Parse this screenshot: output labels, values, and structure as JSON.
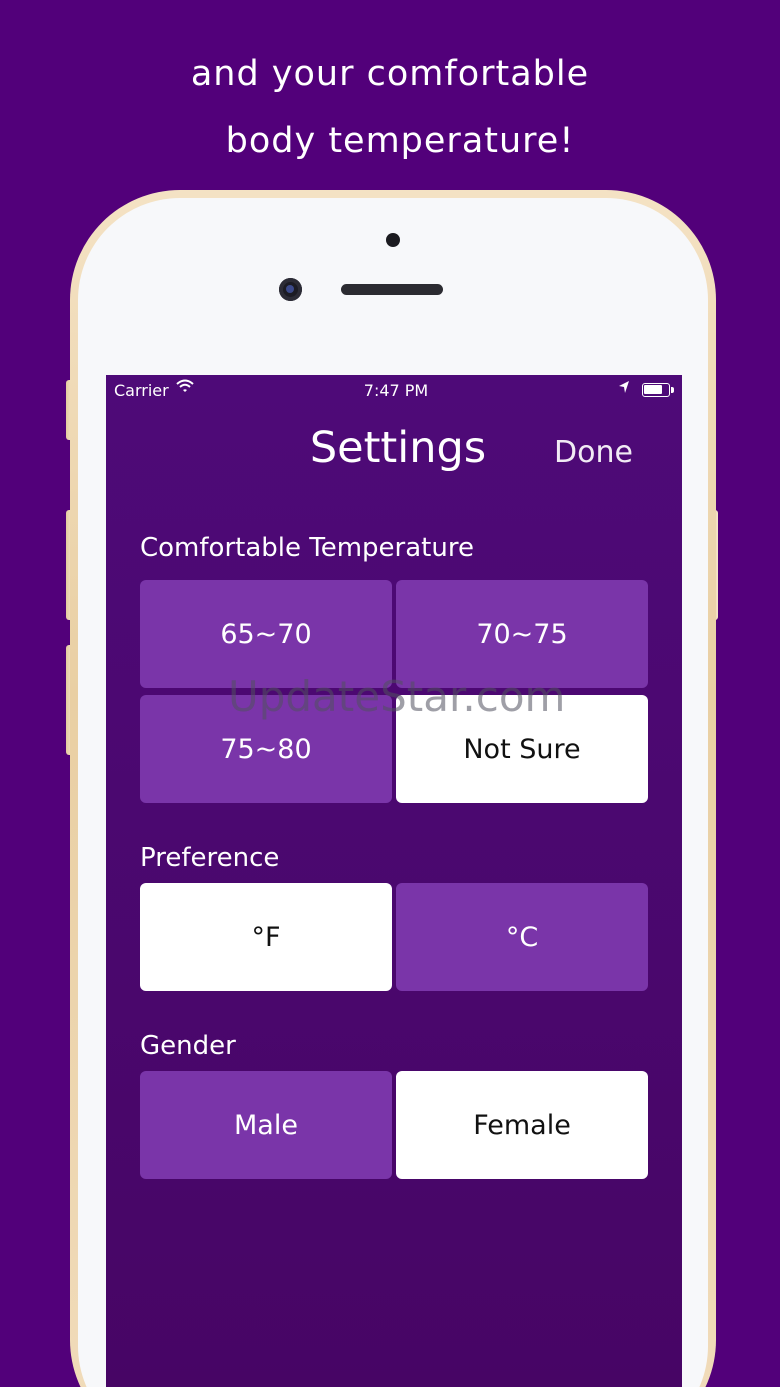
{
  "caption": {
    "line1": "and your comfortable",
    "line2": "body temperature!"
  },
  "status_bar": {
    "carrier": "Carrier",
    "wifi_icon": "wifi-icon",
    "time": "7:47 PM",
    "location_icon": "location-arrow-icon",
    "battery_icon": "battery-icon"
  },
  "nav": {
    "title": "Settings",
    "done_label": "Done"
  },
  "sections": {
    "temperature": {
      "label": "Comfortable Temperature",
      "options": [
        "65~70",
        "70~75",
        "75~80",
        "Not Sure"
      ],
      "selected": "Not Sure"
    },
    "preference": {
      "label": "Preference",
      "options": [
        "°F",
        "°C"
      ],
      "selected": "°F"
    },
    "gender": {
      "label": "Gender",
      "options": [
        "Male",
        "Female"
      ],
      "selected": "Female"
    }
  },
  "watermark": "UpdateStar.com",
  "colors": {
    "background": "#52007a",
    "screen": "#4e0a78",
    "option_unselected": "#7a35a9",
    "option_selected": "#ffffff"
  }
}
